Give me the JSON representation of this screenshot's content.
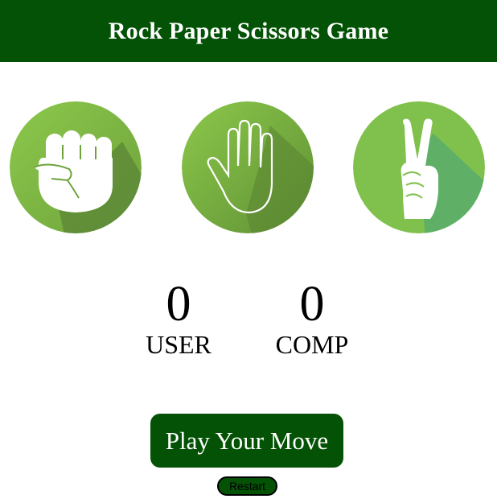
{
  "header": {
    "title": "Rock Paper Scissors Game",
    "background": "#045205"
  },
  "choices": [
    {
      "name": "rock",
      "icon": "fist-icon"
    },
    {
      "name": "paper",
      "icon": "open-hand-icon"
    },
    {
      "name": "scissors",
      "icon": "peace-sign-icon"
    }
  ],
  "scores": {
    "user": {
      "value": "0",
      "label": "USER"
    },
    "comp": {
      "value": "0",
      "label": "COMP"
    }
  },
  "actions": {
    "play_label": "Play Your Move",
    "restart_label": "Restart"
  },
  "colors": {
    "accent_dark_green": "#045205",
    "circle_green": "#8bc34a",
    "shadow_green": "#5b8c35"
  }
}
